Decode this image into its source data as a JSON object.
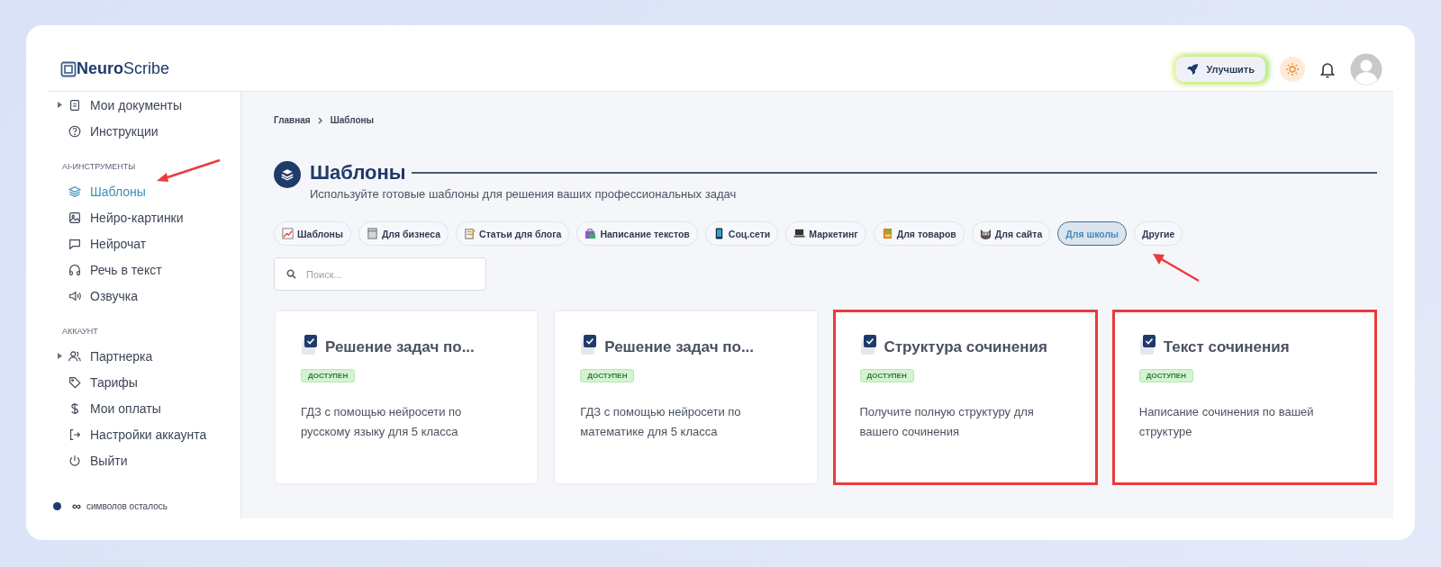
{
  "header": {
    "logo_bold": "Neuro",
    "logo_light": "Scribe",
    "upgrade_button": "Улучшить"
  },
  "sidebar": {
    "sections": [
      {
        "items": [
          {
            "label": "Мои документы",
            "expandable": true,
            "selected": false
          },
          {
            "label": "Инструкции",
            "expandable": false,
            "selected": false
          }
        ]
      },
      {
        "heading": "AI-ИНСТРУМЕНТЫ",
        "items": [
          {
            "label": "Шаблоны",
            "expandable": false,
            "selected": true
          },
          {
            "label": "Нейро-картинки",
            "expandable": false,
            "selected": false
          },
          {
            "label": "Нейрочат",
            "expandable": false,
            "selected": false
          },
          {
            "label": "Речь в текст",
            "expandable": false,
            "selected": false
          },
          {
            "label": "Озвучка",
            "expandable": false,
            "selected": false
          }
        ]
      },
      {
        "heading": "АККАУНТ",
        "items": [
          {
            "label": "Партнерка",
            "expandable": true,
            "selected": false
          },
          {
            "label": "Тарифы",
            "expandable": false,
            "selected": false
          },
          {
            "label": "Мои оплаты",
            "expandable": false,
            "selected": false
          },
          {
            "label": "Настройки аккаунта",
            "expandable": false,
            "selected": false
          },
          {
            "label": "Выйти",
            "expandable": false,
            "selected": false
          }
        ]
      }
    ],
    "footer": {
      "symbol": "∞",
      "text": "символов осталось",
      "color": "#1f3a6b"
    }
  },
  "breadcrumb": [
    "Главная",
    "Шаблоны"
  ],
  "page": {
    "title": "Шаблоны",
    "subtitle": "Используйте готовые шаблоны для решения ваших профессиональных задач"
  },
  "chips": [
    {
      "label": "Шаблоны",
      "selected": false
    },
    {
      "label": "Для бизнеса",
      "selected": false
    },
    {
      "label": "Статьи для блога",
      "selected": false
    },
    {
      "label": "Написание текстов",
      "selected": false
    },
    {
      "label": "Соц.сети",
      "selected": false
    },
    {
      "label": "Маркетинг",
      "selected": false
    },
    {
      "label": "Для товаров",
      "selected": false
    },
    {
      "label": "Для сайта",
      "selected": false
    },
    {
      "label": "Для школы",
      "selected": true
    },
    {
      "label": "Другие",
      "selected": false
    }
  ],
  "search": {
    "placeholder": "Поиск..."
  },
  "cards": [
    {
      "title": "Решение задач по...",
      "badge": "ДОСТУПЕН",
      "description": "ГДЗ с помощью нейросети по русскому языку для 5 класса",
      "highlighted": false
    },
    {
      "title": "Решение задач по...",
      "badge": "ДОСТУПЕН",
      "description": "ГДЗ с помощью нейросети по математике для 5 класса",
      "highlighted": false
    },
    {
      "title": "Структура сочинения",
      "badge": "ДОСТУПЕН",
      "description": "Получите полную структуру для вашего сочинения",
      "highlighted": true
    },
    {
      "title": "Текст сочинения",
      "badge": "ДОСТУПЕН",
      "description": "Написание сочинения по вашей структуре",
      "highlighted": true
    }
  ]
}
